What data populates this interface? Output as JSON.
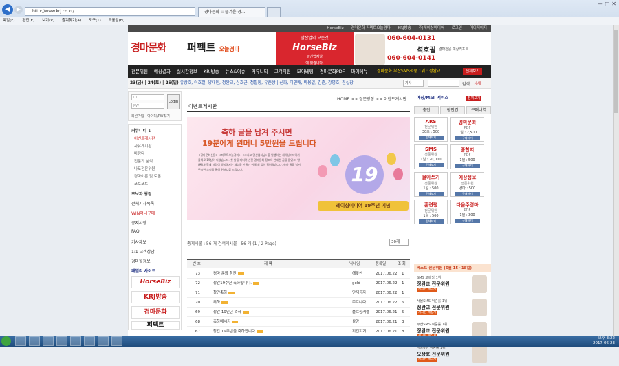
{
  "browser": {
    "url": "http://www.krj.co.kr/",
    "tab_title": "경마문화 :: 즐겨운 경...",
    "search_icon": "search-icon",
    "menu": [
      "파일(F)",
      "편집(E)",
      "보기(V)",
      "즐겨찾기(A)",
      "도구(T)",
      "도움말(H)"
    ]
  },
  "site": {
    "topnav": [
      "HorseBiz",
      "경마문화 퍼펙트오늘경마",
      "KRJ방송",
      "주)레이싱미디어",
      "로그인",
      "마이페이지"
    ],
    "logo_main": "경마문화",
    "logo_perfect": "퍼펙트",
    "logo_today": "오늘경마",
    "horsebiz": {
      "line1": "말산업의 모든것",
      "name": "HorseBiz",
      "line3": "말산업지남",
      "line4": "에 있습니다."
    },
    "promo_phone1": "060-604-0131",
    "promo_name": "석호필",
    "promo_role": "경마전문 예상리포트",
    "promo_phone2": "060-604-0141",
    "mainnav": [
      "전문위원",
      "예상결과",
      "실시간정보",
      "KRJ방송",
      "뉴스&이슈",
      "커뮤니티",
      "고객지원",
      "모아베팅",
      "경마문화PDF",
      "마이메뉴"
    ],
    "mainnav_promo": "경마문화 부산SMS적중 1위 : 정완교",
    "view_all": "전체보기",
    "dates": "23(금) | 24(토) | 25(일)",
    "names": "유상호, 이호철, 양대인, 정완교, 심호근, 정필동, 유준상 | 신화, 이인배, 박용일, 김준, 강명호, 전실장",
    "search_select": "기사",
    "search_btn": "검색",
    "detail_btn": "상세"
  },
  "left": {
    "id_label": "ID",
    "pw_label": "PW",
    "login_btn": "Login",
    "join": "회원가입 · 아이디/PW찾기",
    "community_title": "커뮤니티 ↓",
    "community": [
      "이벤트게시판",
      "자유게시판",
      "바탕다",
      "전문가 분석",
      "나도전문위원",
      "경마이론 및 토론",
      "포토포토"
    ],
    "beginner_title": "초보자 광장",
    "beginner": [
      "전체기사목록",
      "WIN머니구매",
      "공지사항",
      "FAQ",
      "기사제보",
      "1:1 고객상담",
      "경마월정보"
    ],
    "family_title": "패밀리 사이트",
    "family": [
      "HorseBiz",
      "KRJ방송",
      "경마문화",
      "퍼펙트"
    ]
  },
  "content": {
    "breadcrumb": "HOME >> 경문광장 >> 이벤트게시판",
    "title": "이벤트게시판",
    "banner_line1": "축하 글을 남겨 주시면",
    "banner_line2": "19분에게 윈머니 5만원을 드립니다",
    "banner_body": "<경마문화신문> <퍼펙트오늘경마> <그리고 말산업지남>을 발행하는 레이싱미디어가 올해로 19살이 되었습니다. 첫 발을 디디며 선진 경마문화 정조의 현대한 꿈을 품었고, 말(馬)과 함께 사람이 행복해지는 세상을 만들기 위해 쉼 없이 달려왔습니다. 축하 글을 남겨 주시면 추첨을 통해 윈머니를 드립니다.",
    "banner_num": "19",
    "banner_tag": "레이싱미디어 19주년 기념",
    "stats": "총게시물 : 56 개     검색게시물 : 56 개 (1 / 2 Page)",
    "select_count": "30개",
    "headers": [
      "번 호",
      "제 목",
      "닉네임",
      "등록일",
      "조 회"
    ],
    "rows": [
      {
        "no": "73",
        "title": "경마 문화 창간",
        "nick": "해맞산",
        "date": "2017.06.22",
        "views": "1"
      },
      {
        "no": "72",
        "title": "창간19주년 축하합니다.",
        "nick": "gold",
        "date": "2017.06.22",
        "views": "1"
      },
      {
        "no": "71",
        "title": "창간축하",
        "nick": "만재공자",
        "date": "2017.06.22",
        "views": "1"
      },
      {
        "no": "70",
        "title": "축하",
        "nick": "쭈르나다",
        "date": "2017.06.22",
        "views": "6"
      },
      {
        "no": "69",
        "title": "창간 19인년 축하",
        "nick": "풀르항커렐",
        "date": "2017.06.21",
        "views": "5"
      },
      {
        "no": "68",
        "title": "축하메시지",
        "nick": "삼양",
        "date": "2017.06.21",
        "views": "3"
      },
      {
        "no": "67",
        "title": "창간 19주년을 축하합니다",
        "nick": "지건지기",
        "date": "2017.06.21",
        "views": "8"
      }
    ]
  },
  "right": {
    "title": "예상/Mall 서비스",
    "title_btn": "전체보기",
    "tabs": [
      "충전",
      "장인권",
      "구매내역"
    ],
    "cards": [
      {
        "t": "ARS",
        "s": "전문위원",
        "p": "30초 : 500",
        "b": "전체보기"
      },
      {
        "t": "경마문화",
        "s": "PDF",
        "p": "1일 : 2,500",
        "b": "구매하기"
      },
      {
        "t": "SMS",
        "s": "전문위원",
        "p": "1일 : 20,000",
        "b": "전체보기"
      },
      {
        "t": "종합지",
        "s": "PDF",
        "p": "1일 : 500",
        "b": "구매하기"
      },
      {
        "t": "몰아쓰기",
        "s": "전문위원",
        "p": "1일 : 500",
        "b": "전체보기"
      },
      {
        "t": "예상정보",
        "s": "전문위원",
        "p": "경마 : 500",
        "b": "구매하기"
      },
      {
        "t": "훈련평",
        "s": "전문위원",
        "p": "1일 : 500",
        "b": "전체보기"
      },
      {
        "t": "다음주경마",
        "s": "PDF",
        "p": "1일 : 300",
        "b": "구매하기"
      }
    ],
    "best_title": "베스트 전문위원 (6월 15~18일)",
    "best": [
      {
        "a": "SMS 고배당 1위",
        "b": "정완교 전문위원",
        "c": "제시된 예상지"
      },
      {
        "a": "서울SMS 적중률 1위",
        "b": "정완교 전문위원",
        "c": "제시된 예상지"
      },
      {
        "a": "부산SMS 적중률 1위",
        "b": "정완교 전문위원",
        "c": "제시된 예상지"
      },
      {
        "a": "서울6두 적중률 1위",
        "b": "오상호 전문위원",
        "c": "제시된 예상지"
      }
    ]
  },
  "taskbar": {
    "time": "오후 3:22",
    "date": "2017-06-23"
  }
}
